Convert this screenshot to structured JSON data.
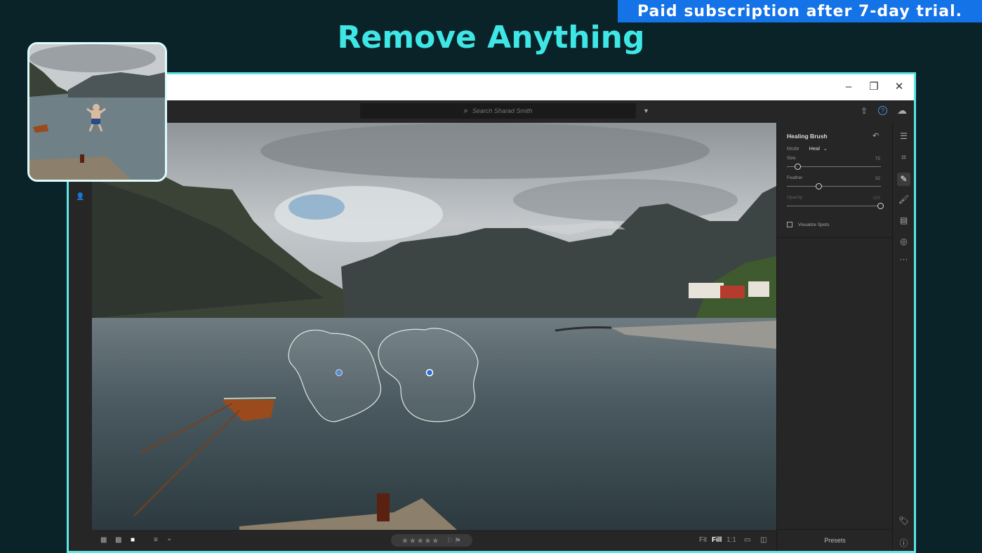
{
  "promo": {
    "banner_text": "Paid subscription after 7-day trial.",
    "headline": "Remove Anything",
    "accent_color": "#3fe6e6",
    "banner_color": "#1473e6"
  },
  "window": {
    "minimize": "–",
    "restore": "❐",
    "close": "✕"
  },
  "toolbar": {
    "search_placeholder": "Search Sharad Smith",
    "search_icon": "⌕",
    "filter_icon": "▼",
    "share_icon": "⇪",
    "help_icon": "?",
    "cloud_icon": "☁"
  },
  "left_strip": {
    "people_icon": "👤"
  },
  "edit_panel": {
    "title": "Healing Brush",
    "reset_icon": "↶",
    "mode_label": "Mode",
    "mode_value": "Heal",
    "mode_chevron": "⌄",
    "sliders": [
      {
        "label": "Size",
        "value": "75",
        "fraction": 0.12
      },
      {
        "label": "Feather",
        "value": "32",
        "fraction": 0.34
      },
      {
        "label": "Opacity",
        "value": "100",
        "fraction": 1.0
      }
    ],
    "visualize_spots": "Visualize Spots",
    "presets": "Presets"
  },
  "tool_strip": [
    {
      "name": "sliders-icon",
      "glyph": "☰"
    },
    {
      "name": "crop-icon",
      "glyph": "⌗"
    },
    {
      "name": "healing-brush-icon",
      "glyph": "✎"
    },
    {
      "name": "brush-icon",
      "glyph": "🖌"
    },
    {
      "name": "linear-gradient-icon",
      "glyph": "▤"
    },
    {
      "name": "radial-gradient-icon",
      "glyph": "◎"
    },
    {
      "name": "more-icon",
      "glyph": "···"
    },
    {
      "name": "tag-icon",
      "glyph": "🏷"
    },
    {
      "name": "info-icon",
      "glyph": "ⓘ"
    }
  ],
  "bottom_bar": {
    "grid_small_icon": "▦",
    "grid_large_icon": "▩",
    "single_view_icon": "■",
    "sort_icon": "≡",
    "sort_chevron": "⌄",
    "stars": "★★★★★",
    "flags": "⚐⚑",
    "fit": "Fit",
    "fill": "Fill",
    "one_to_one": "1:1",
    "filmstrip_icon": "▭",
    "compare_icon": "◫"
  }
}
